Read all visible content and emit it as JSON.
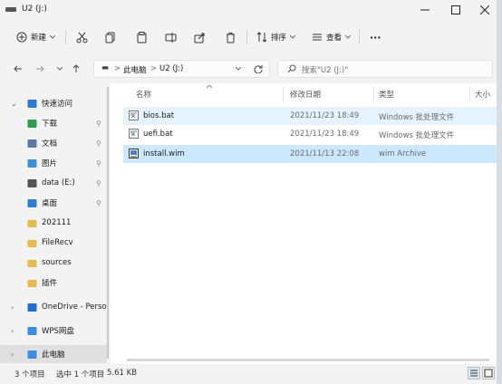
{
  "window": {
    "title": "U2 (J:)"
  },
  "toolbar": {
    "new_label": "新建",
    "sort_label": "排序",
    "view_label": "查看",
    "more_glyph": "···"
  },
  "address": {
    "root_glyph": "▬",
    "crumbs": [
      "此电脑",
      "U2 (J:)"
    ],
    "separator": ">",
    "search_placeholder": "搜索\"U2 (J:)\""
  },
  "sidebar": {
    "items": [
      {
        "label": "快速访问",
        "icon": "star-icon",
        "color": "#2b7bd6"
      },
      {
        "label": "下载",
        "icon": "download-icon",
        "color": "#2a9d4f",
        "pinned": true
      },
      {
        "label": "文档",
        "icon": "document-icon",
        "color": "#5a7aa8",
        "pinned": true
      },
      {
        "label": "图片",
        "icon": "picture-icon",
        "color": "#3b8fd6",
        "pinned": true
      },
      {
        "label": "data (E:)",
        "icon": "drive-icon",
        "color": "#555555",
        "pinned": true
      },
      {
        "label": "桌面",
        "icon": "desktop-icon",
        "color": "#2f7fd0",
        "pinned": true
      },
      {
        "label": "202111",
        "icon": "folder-icon",
        "color": "#e8b84a"
      },
      {
        "label": "FileRecv",
        "icon": "folder-icon",
        "color": "#e8b84a"
      },
      {
        "label": "sources",
        "icon": "folder-icon",
        "color": "#e8b84a"
      },
      {
        "label": "插件",
        "icon": "folder-icon",
        "color": "#e8b84a"
      },
      {
        "label": "OneDrive - Persona",
        "icon": "cloud-icon",
        "color": "#1f6fd0"
      },
      {
        "label": "WPS网盘",
        "icon": "cloud-icon",
        "color": "#3a8ee6"
      },
      {
        "label": "此电脑",
        "icon": "computer-icon",
        "color": "#3a8ee6"
      }
    ]
  },
  "columns": {
    "name": "名称",
    "date": "修改日期",
    "type": "类型",
    "size": "大小"
  },
  "files": [
    {
      "name": "bios.bat",
      "date": "2021/11/23 18:49",
      "type": "Windows 批处理文件",
      "icon": "batch-file-icon"
    },
    {
      "name": "uefi.bat",
      "date": "2021/11/23 18:49",
      "type": "Windows 批处理文件",
      "icon": "batch-file-icon"
    },
    {
      "name": "install.wim",
      "date": "2021/11/13 22:08",
      "type": "wim Archive",
      "icon": "wim-file-icon"
    }
  ],
  "status": {
    "count": "3 个项目",
    "selected": "选中 1 个项目",
    "size": "5.61 KB"
  }
}
